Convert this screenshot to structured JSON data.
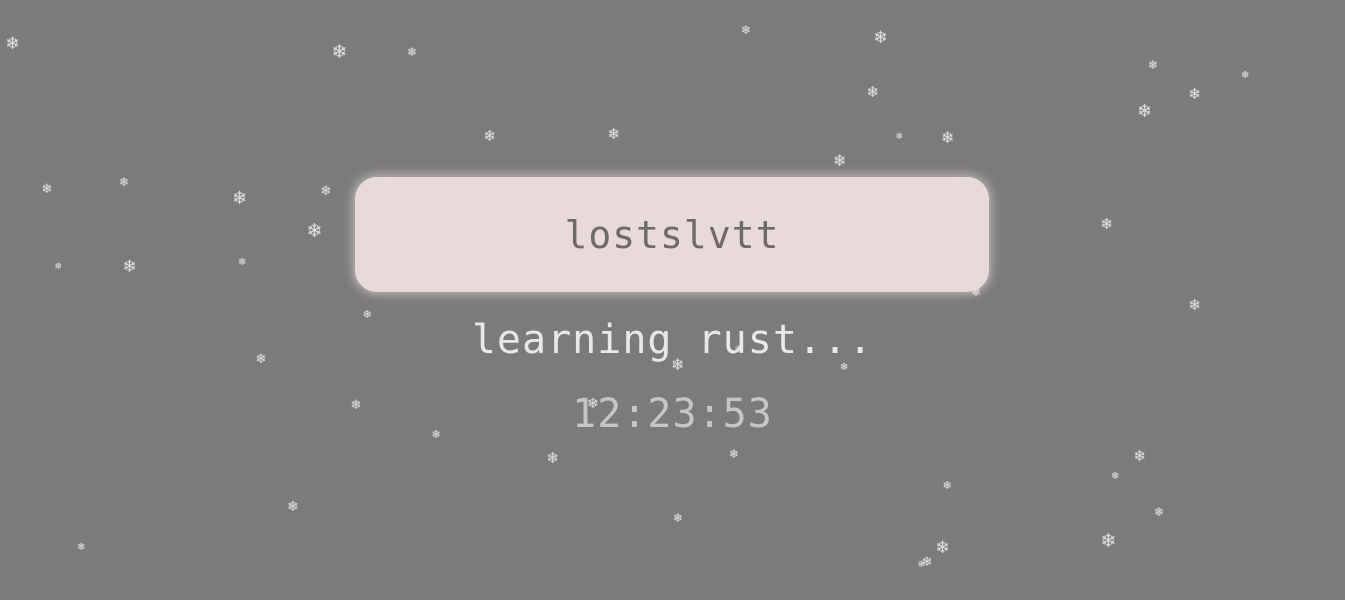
{
  "profile": {
    "username": "lostslvtt",
    "status": "learning rust...",
    "time": "12:23:53"
  },
  "decorations": {
    "snowflake_glyph": "❄",
    "snowflake_icon": "snowflake-icon",
    "snowflake_color": "#e6e6e6"
  },
  "colors": {
    "background": "#7b7b7b",
    "card_background": "#e8dada",
    "username_text": "#6e6a6a",
    "status_text": "#e8e8e8",
    "clock_text": "#c6c6c6"
  }
}
